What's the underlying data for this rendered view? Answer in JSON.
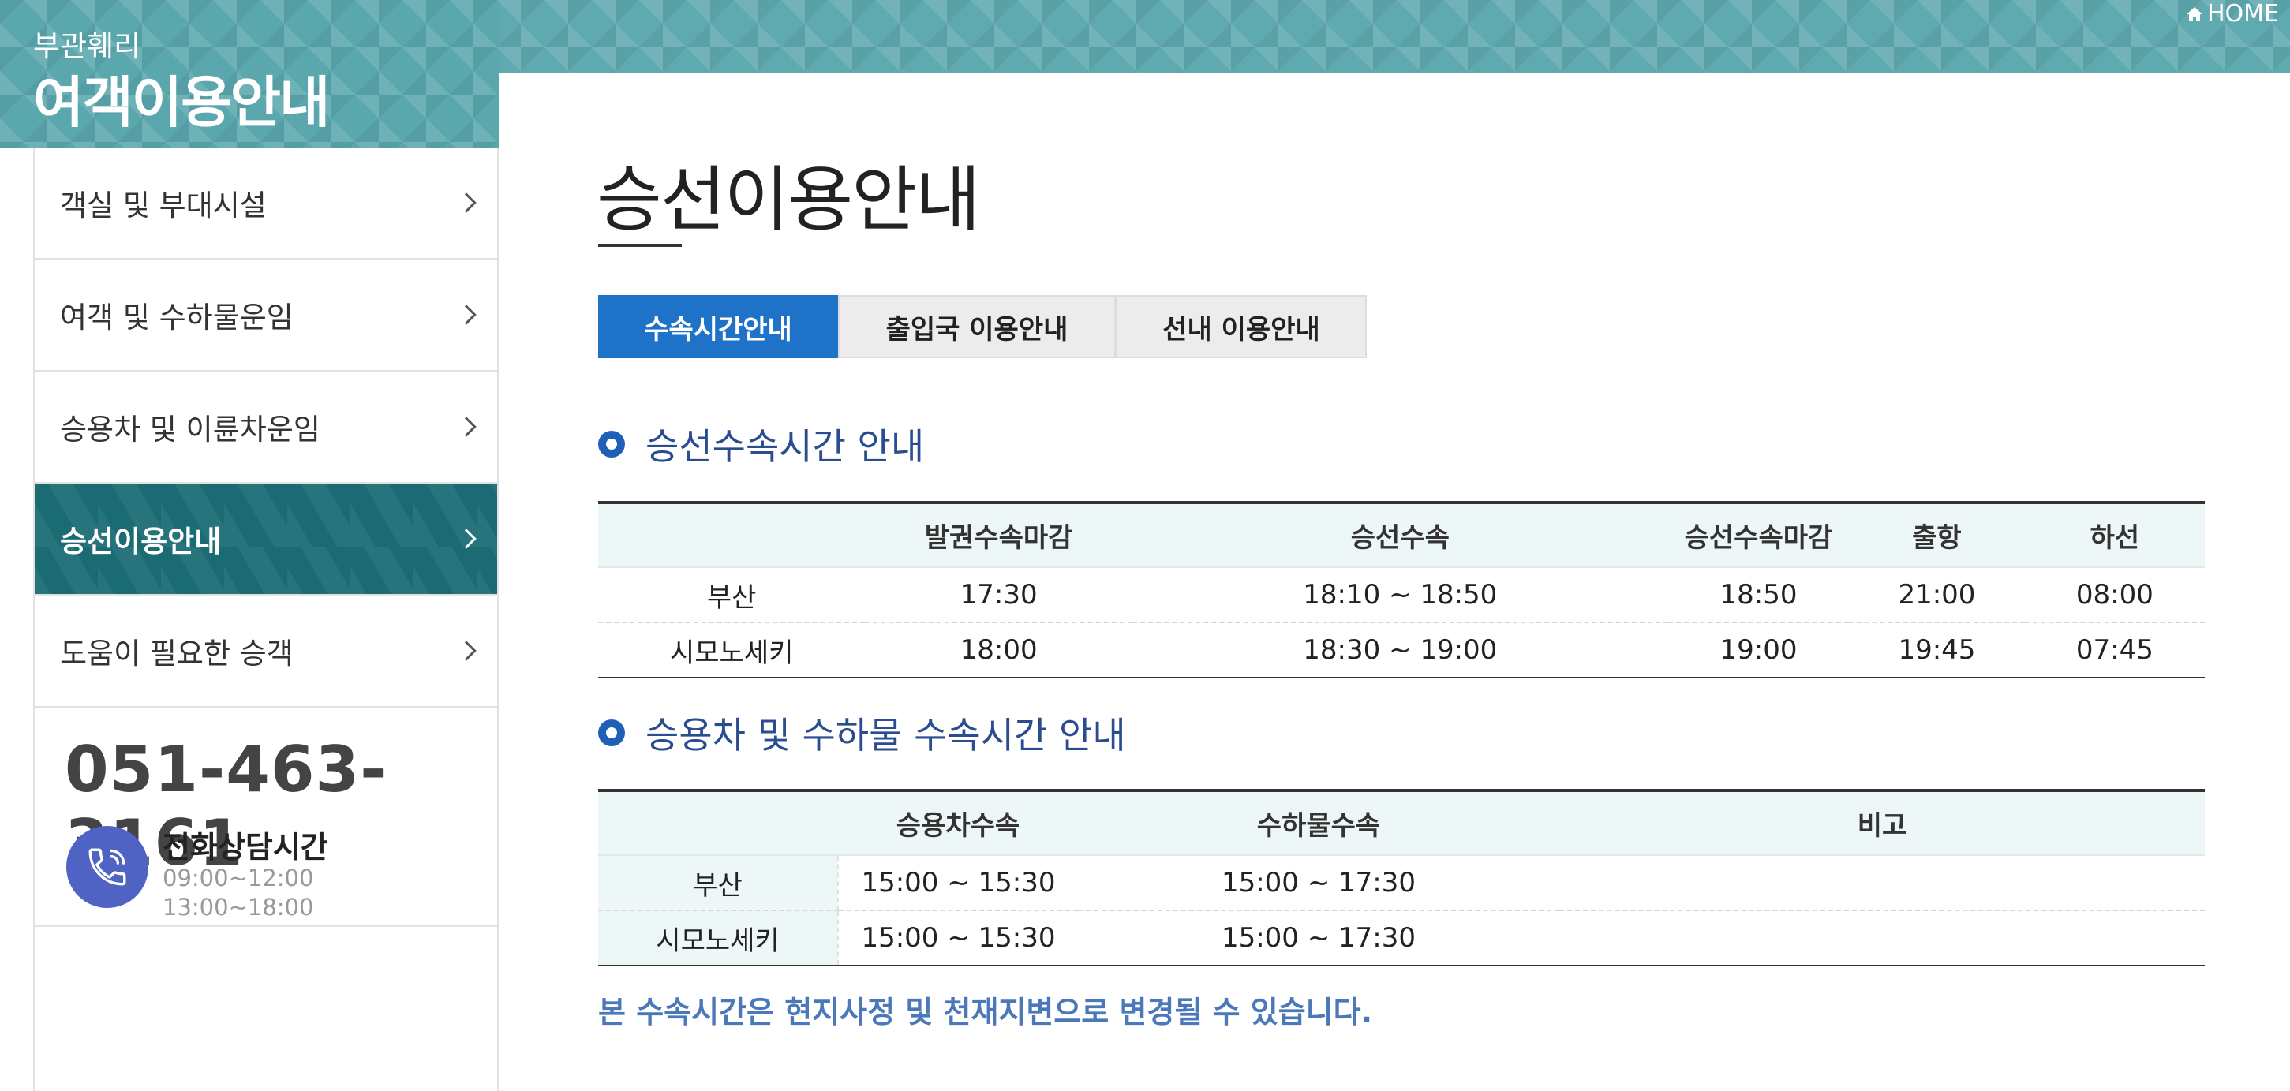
{
  "header": {
    "subtitle": "부관훼리",
    "title": "여객이용안내",
    "home_label": "HOME"
  },
  "sidebar": {
    "items": [
      {
        "label": "객실 및 부대시설",
        "active": false
      },
      {
        "label": "여객 및 수하물운임",
        "active": false
      },
      {
        "label": "승용차 및 이륜차운임",
        "active": false
      },
      {
        "label": "승선이용안내",
        "active": true
      },
      {
        "label": "도움이 필요한 승객",
        "active": false
      }
    ],
    "phone": {
      "number": "051-463-3161",
      "label": "전화상담시간",
      "hours1": "09:00~12:00",
      "hours2": "13:00~18:00"
    }
  },
  "page": {
    "title": "승선이용안내",
    "tabs": [
      {
        "label": "수속시간안내",
        "active": true
      },
      {
        "label": "출입국 이용안내",
        "active": false
      },
      {
        "label": "선내 이용안내",
        "active": false
      }
    ]
  },
  "boarding": {
    "heading": "승선수속시간 안내",
    "columns": [
      "",
      "발권수속마감",
      "승선수속",
      "승선수속마감",
      "출항",
      "하선"
    ],
    "rows": [
      [
        "부산",
        "17:30",
        "18:10 ~ 18:50",
        "18:50",
        "21:00",
        "08:00"
      ],
      [
        "시모노세키",
        "18:00",
        "18:30 ~ 19:00",
        "19:00",
        "19:45",
        "07:45"
      ]
    ]
  },
  "vehicle": {
    "heading": "승용차 및 수하물 수속시간 안내",
    "columns": [
      "",
      "승용차수속",
      "수하물수속",
      "비고"
    ],
    "rows": [
      [
        "부산",
        "15:00 ~ 15:30",
        "15:00 ~ 17:30",
        ""
      ],
      [
        "시모노세키",
        "15:00 ~ 15:30",
        "15:00 ~ 17:30",
        ""
      ]
    ]
  },
  "notice": "본 수속시간은 현지사정 및 천재지변으로 변경될 수 있습니다.",
  "colors": {
    "header_teal": "#5fa9b0",
    "active_menu": "#1b6b74",
    "active_tab": "#1e73c8",
    "heading_blue": "#2a4d8f",
    "notice_blue": "#4a78b8",
    "phone_icon_bg": "#4f63c5"
  }
}
